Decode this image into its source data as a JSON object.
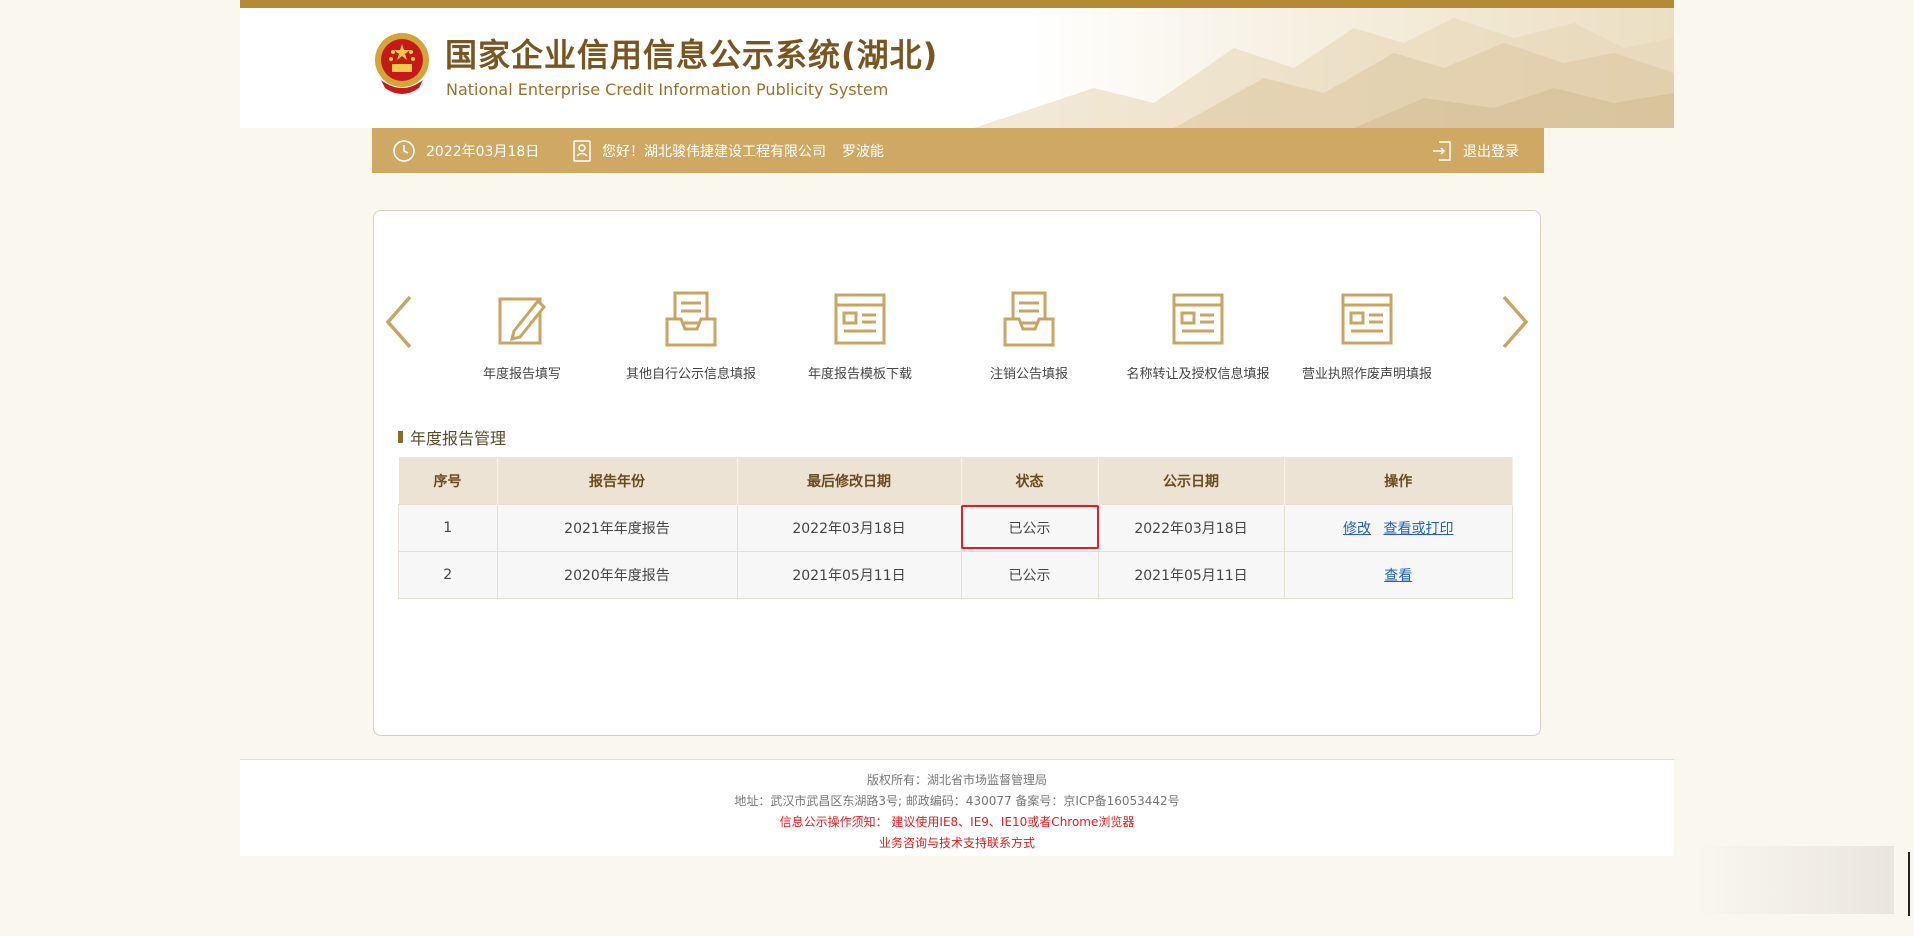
{
  "header": {
    "title_cn": "国家企业信用信息公示系统(湖北)",
    "title_en": "National Enterprise Credit Information Publicity System"
  },
  "navbar": {
    "date": "2022年03月18日",
    "greeting": "您好！湖北骏伟捷建设工程有限公司",
    "user": "罗波能",
    "logout": "退出登录"
  },
  "functions": [
    {
      "label": "年度报告填写",
      "icon": "pencil-edit-icon"
    },
    {
      "label": "其他自行公示信息填报",
      "icon": "inbox-tray-icon"
    },
    {
      "label": "年度报告模板下载",
      "icon": "document-list-icon"
    },
    {
      "label": "注销公告填报",
      "icon": "inbox-tray-icon"
    },
    {
      "label": "名称转让及授权信息填报",
      "icon": "document-list-icon"
    },
    {
      "label": "营业执照作废声明填报",
      "icon": "document-list-icon"
    }
  ],
  "section": {
    "title": "年度报告管理"
  },
  "table": {
    "headers": [
      "序号",
      "报告年份",
      "最后修改日期",
      "状态",
      "公示日期",
      "操作"
    ],
    "rows": [
      {
        "no": "1",
        "year": "2021年年度报告",
        "modified": "2022年03月18日",
        "status": "已公示",
        "published": "2022年03月18日",
        "actions": [
          "修改",
          "查看或打印"
        ]
      },
      {
        "no": "2",
        "year": "2020年年度报告",
        "modified": "2021年05月11日",
        "status": "已公示",
        "published": "2021年05月11日",
        "actions": [
          "查看"
        ]
      }
    ]
  },
  "footer": {
    "copyright": "版权所有：湖北省市场监督管理局",
    "address": "地址：武汉市武昌区东湖路3号; 邮政编码：430077 备案号：京ICP备16053442号",
    "notice": "信息公示操作须知： 建议使用IE8、IE9、IE10或者Chrome浏览器",
    "support": "业务咨询与技术支持联系方式"
  },
  "colors": {
    "accent": "#cfa863",
    "title": "#7a5520",
    "link": "#1f5fc6",
    "highlight": "#e02020"
  }
}
